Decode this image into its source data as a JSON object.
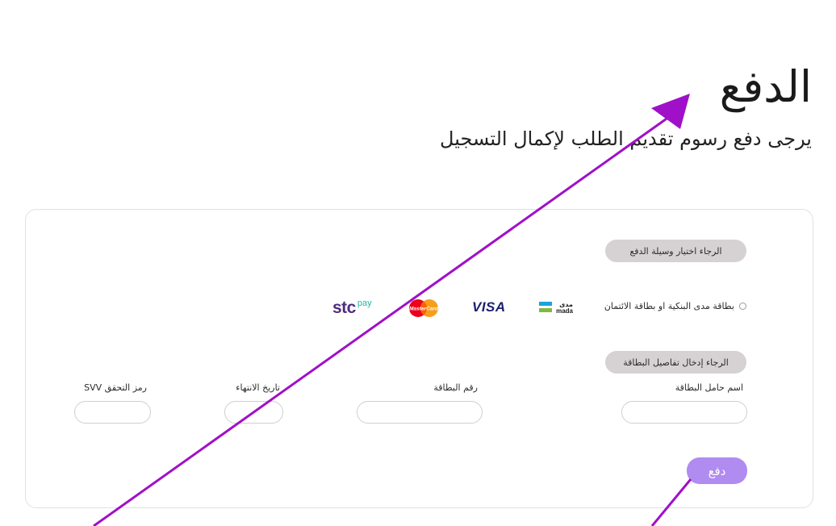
{
  "header": {
    "title": "الدفع",
    "subtitle": "يرجى دفع رسوم تقديم الطلب لإكمال التسجيل"
  },
  "payment_method": {
    "section_label": "الرجاء اختيار وسيلة الدفع",
    "option_label": "بطاقة مدى البنكية او بطاقة الائتمان",
    "logos": {
      "mada": {
        "arabic": "مدى",
        "latin": "mada"
      },
      "visa": "VISA",
      "mastercard": "MasterCard",
      "stcpay": {
        "brand": "stc",
        "suffix": "pay"
      }
    }
  },
  "card_details": {
    "section_label": "الرجاء إدخال تفاصيل البطاقة",
    "fields": {
      "holder_label": "اسم حامل البطاقة",
      "holder_value": "",
      "number_label": "رقم البطاقة",
      "number_value": "",
      "expiry_label": "تاريخ الانتهاء",
      "expiry_value": "",
      "cvv_label": "رمز التحقق SVV",
      "cvv_value": ""
    }
  },
  "actions": {
    "pay_label": "دفع"
  },
  "colors": {
    "pay_button": "#b08bf0",
    "pill_bg": "#d6d2d3",
    "annotation_arrow": "#a010c8"
  }
}
